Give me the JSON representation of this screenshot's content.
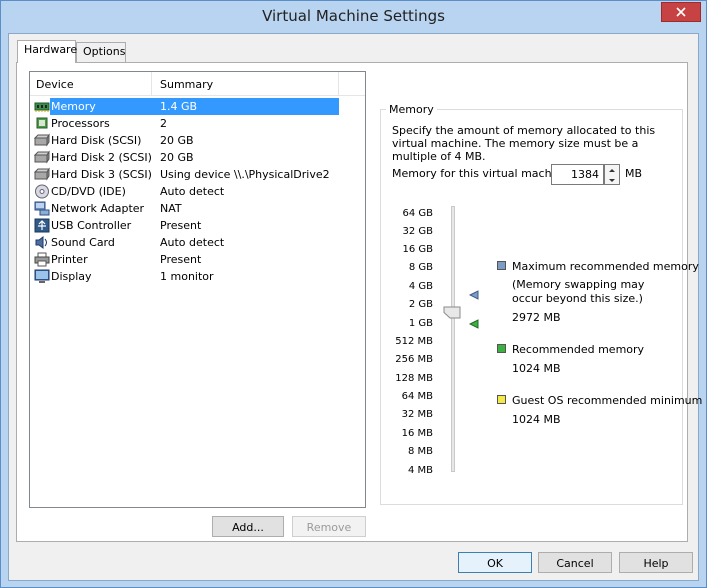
{
  "window": {
    "title": "Virtual Machine Settings"
  },
  "tabs": [
    {
      "label": "Hardware",
      "active": true
    },
    {
      "label": "Options",
      "active": false
    }
  ],
  "device_list": {
    "columns": [
      "Device",
      "Summary"
    ],
    "rows": [
      {
        "device": "Memory",
        "summary": "1.4 GB",
        "icon": "memory-icon",
        "selected": true
      },
      {
        "device": "Processors",
        "summary": "2",
        "icon": "processor-icon"
      },
      {
        "device": "Hard Disk (SCSI)",
        "summary": "20 GB",
        "icon": "hard-disk-icon"
      },
      {
        "device": "Hard Disk 2 (SCSI)",
        "summary": "20 GB",
        "icon": "hard-disk-icon"
      },
      {
        "device": "Hard Disk 3 (SCSI)",
        "summary": "Using device \\\\.\\PhysicalDrive2",
        "icon": "hard-disk-icon"
      },
      {
        "device": "CD/DVD (IDE)",
        "summary": "Auto detect",
        "icon": "cd-dvd-icon"
      },
      {
        "device": "Network Adapter",
        "summary": "NAT",
        "icon": "network-adapter-icon"
      },
      {
        "device": "USB Controller",
        "summary": "Present",
        "icon": "usb-icon"
      },
      {
        "device": "Sound Card",
        "summary": "Auto detect",
        "icon": "sound-card-icon"
      },
      {
        "device": "Printer",
        "summary": "Present",
        "icon": "printer-icon"
      },
      {
        "device": "Display",
        "summary": "1 monitor",
        "icon": "display-icon"
      }
    ]
  },
  "list_buttons": {
    "add": "Add...",
    "remove": "Remove"
  },
  "memory": {
    "group_label": "Memory",
    "description": "Specify the amount of memory allocated to this virtual machine. The memory size must be a multiple of 4 MB.",
    "field_label": "Memory for this virtual machine:",
    "value": "1384",
    "unit": "MB",
    "ticks": [
      "64 GB",
      "32 GB",
      "16 GB",
      "8 GB",
      "4 GB",
      "2 GB",
      "1 GB",
      "512 MB",
      "256 MB",
      "128 MB",
      "64 MB",
      "32 MB",
      "16 MB",
      "8 MB",
      "4 MB"
    ],
    "legend": {
      "max_label": "Maximum recommended memory",
      "max_note_1": "(Memory swapping may",
      "max_note_2": "occur beyond this size.)",
      "max_value": "2972 MB",
      "rec_label": "Recommended memory",
      "rec_value": "1024 MB",
      "min_label": "Guest OS recommended minimum",
      "min_value": "1024 MB"
    },
    "colors": {
      "max": "#7a9cc6",
      "rec": "#3cb043",
      "min": "#f5e94a"
    }
  },
  "footer": {
    "ok": "OK",
    "cancel": "Cancel",
    "help": "Help"
  }
}
